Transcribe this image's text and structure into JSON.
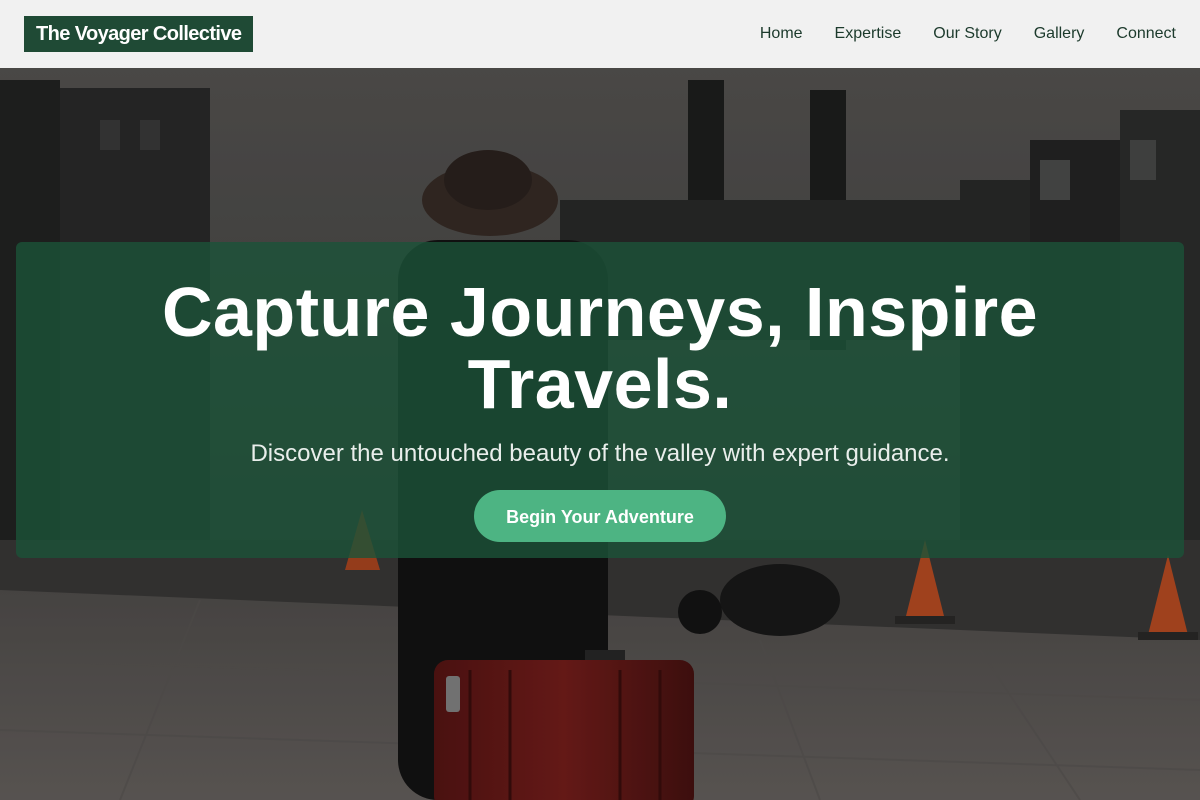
{
  "header": {
    "brand": "The Voyager Collective",
    "nav": [
      {
        "label": "Home"
      },
      {
        "label": "Expertise"
      },
      {
        "label": "Our Story"
      },
      {
        "label": "Gallery"
      },
      {
        "label": "Connect"
      }
    ]
  },
  "hero": {
    "headline_line1": "Capture Journeys, Inspire",
    "headline_line2": "Travels.",
    "subtitle": "Discover the untouched beauty of the valley with expert guidance.",
    "cta_label": "Begin Your Adventure"
  },
  "colors": {
    "brand_bg": "#1f4a35",
    "hero_overlay": "#1b5238",
    "cta": "#4db483",
    "nav_text": "#1c3a2c"
  },
  "background": {
    "subject": "traveler-with-red-suitcase-photo"
  }
}
